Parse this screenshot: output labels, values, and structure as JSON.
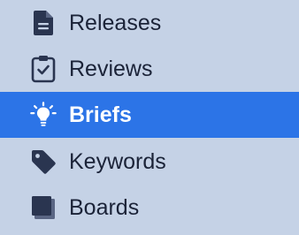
{
  "sidebar": {
    "items": [
      {
        "label": "Releases",
        "icon": "document-icon",
        "selected": false
      },
      {
        "label": "Reviews",
        "icon": "clipboard-check-icon",
        "selected": false
      },
      {
        "label": "Briefs",
        "icon": "lightbulb-icon",
        "selected": true
      },
      {
        "label": "Keywords",
        "icon": "tag-icon",
        "selected": false
      },
      {
        "label": "Boards",
        "icon": "boards-icon",
        "selected": false
      }
    ]
  },
  "colors": {
    "background": "#c5d2e6",
    "selected_background": "#2c74e7",
    "text": "#1b2338",
    "selected_text": "#ffffff",
    "icon": "#2a3550"
  }
}
